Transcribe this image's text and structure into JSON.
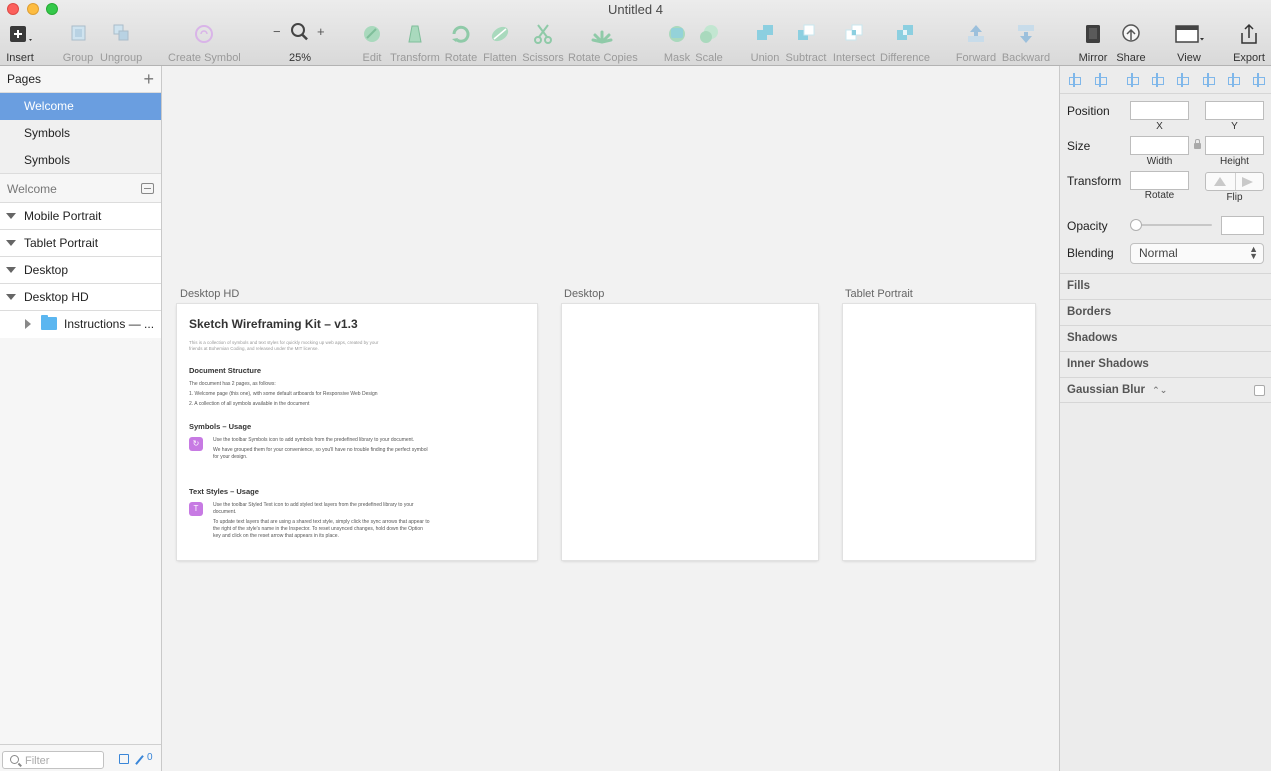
{
  "window": {
    "title": "Untitled 4"
  },
  "toolbar": {
    "insert": "Insert",
    "group": "Group",
    "ungroup": "Ungroup",
    "create_symbol": "Create Symbol",
    "zoom_level": "25%",
    "zoom_minus": "−",
    "zoom_plus": "+",
    "edit": "Edit",
    "transform": "Transform",
    "rotate": "Rotate",
    "flatten": "Flatten",
    "scissors": "Scissors",
    "rotate_copies": "Rotate Copies",
    "mask": "Mask",
    "scale": "Scale",
    "union": "Union",
    "subtract": "Subtract",
    "intersect": "Intersect",
    "difference": "Difference",
    "forward": "Forward",
    "backward": "Backward",
    "mirror": "Mirror",
    "share": "Share",
    "view": "View",
    "export": "Export"
  },
  "sidebar": {
    "pages_title": "Pages",
    "add_symbol": "+",
    "pages": [
      {
        "label": "Welcome"
      },
      {
        "label": "Symbols"
      },
      {
        "label": "Symbols"
      }
    ],
    "layers_title": "Welcome",
    "layers": [
      {
        "label": "Mobile Portrait"
      },
      {
        "label": "Tablet Portrait"
      },
      {
        "label": "Desktop"
      },
      {
        "label": "Desktop HD"
      }
    ],
    "sublayer": "Instructions — ...",
    "filter_placeholder": "Filter",
    "filter_count": "0"
  },
  "canvas": {
    "artboards": [
      {
        "label": "Desktop HD"
      },
      {
        "label": "Desktop"
      },
      {
        "label": "Tablet Portrait"
      }
    ],
    "doc": {
      "title": "Sketch Wireframing Kit – v1.3",
      "intro": "This is a collection of symbols and text styles for quickly mocking up web apps, created by your friends at Bohemian Coding, and released under the MIT license.",
      "structure_heading": "Document Structure",
      "structure_lead": "The document has 2 pages, as follows:",
      "structure_item1": "1.  Welcome page (this one), with some default artboards for Responsive Web Design",
      "structure_item2": "2.  A collection of all symbols available in the document",
      "symbols_heading": "Symbols – Usage",
      "symbols_p1": "Use the toolbar Symbols icon to add symbols from the predefined library to your document.",
      "symbols_p2": "We have grouped them for your convenience, so you'll have no trouble finding the perfect symbol for your design.",
      "text_heading": "Text Styles – Usage",
      "text_p1": "Use the toolbar Styled Text icon to add styled text layers from the predefined library to your document.",
      "text_p2": "To update text layers that are using a shared text style, simply click the sync arrows that appear to the right of the style's name in the Inspector. To reset unsynced changes, hold down the Option key and click on the reset arrow that appears in its place.",
      "text_icon_glyph": "T",
      "symbol_icon_glyph": "↻"
    }
  },
  "inspector": {
    "position": "Position",
    "x": "X",
    "y": "Y",
    "size": "Size",
    "width": "Width",
    "height": "Height",
    "transform": "Transform",
    "rotate": "Rotate",
    "flip": "Flip",
    "opacity": "Opacity",
    "opacity_value": 0,
    "blending": "Blending",
    "blending_value": "Normal",
    "sections": {
      "fills": "Fills",
      "borders": "Borders",
      "shadows": "Shadows",
      "inner_shadows": "Inner Shadows",
      "gaussian_blur": "Gaussian Blur"
    },
    "gaussian_blur_arrows": "⌃⌄"
  },
  "colors": {
    "selection": "#6a9ee0",
    "accent": "#3a86d8",
    "toolbar_icon": "#9fd1b5",
    "boolean_icon": "#8ccfe0",
    "symbol_icon": "#c77ae3"
  }
}
